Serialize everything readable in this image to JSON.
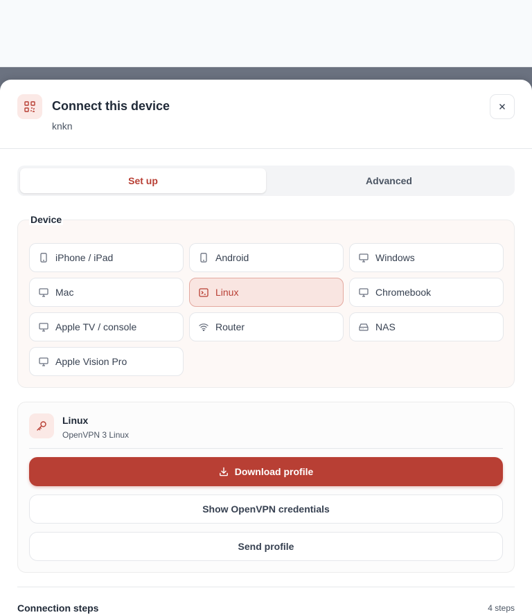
{
  "header": {
    "title": "Connect this device",
    "subtitle": "knkn",
    "icon": "qr-code-icon",
    "close_icon": "close-icon"
  },
  "tabs": [
    {
      "label": "Set up",
      "active": true
    },
    {
      "label": "Advanced",
      "active": false
    }
  ],
  "device_section": {
    "legend": "Device",
    "options": [
      {
        "label": "iPhone / iPad",
        "icon": "phone-icon",
        "selected": false
      },
      {
        "label": "Android",
        "icon": "phone-icon",
        "selected": false
      },
      {
        "label": "Windows",
        "icon": "monitor-icon",
        "selected": false
      },
      {
        "label": "Mac",
        "icon": "monitor-icon",
        "selected": false
      },
      {
        "label": "Linux",
        "icon": "terminal-icon",
        "selected": true
      },
      {
        "label": "Chromebook",
        "icon": "monitor-icon",
        "selected": false
      },
      {
        "label": "Apple TV / console",
        "icon": "monitor-icon",
        "selected": false
      },
      {
        "label": "Router",
        "icon": "wifi-icon",
        "selected": false
      },
      {
        "label": "NAS",
        "icon": "hard-drive-icon",
        "selected": false
      },
      {
        "label": "Apple Vision Pro",
        "icon": "monitor-icon",
        "selected": false
      }
    ]
  },
  "profile": {
    "title": "Linux",
    "subtitle": "OpenVPN 3 Linux",
    "icon": "key-icon",
    "download_label": "Download profile",
    "download_icon": "download-icon",
    "credentials_label": "Show OpenVPN credentials",
    "send_label": "Send profile"
  },
  "steps": {
    "title": "Connection steps",
    "count": "4 steps"
  },
  "colors": {
    "accent": "#b83f34",
    "accent_light": "#fbe9e6",
    "overlay": "#6b7280"
  }
}
